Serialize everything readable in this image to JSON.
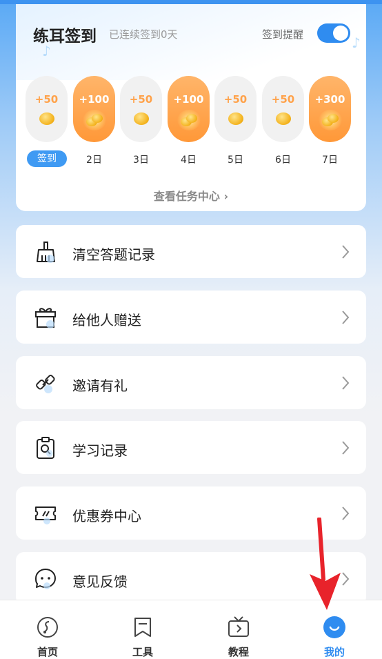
{
  "checkin": {
    "title": "练耳签到",
    "subtitle": "已连续签到0天",
    "reminder_label": "签到提醒",
    "reminder_on": true,
    "days": [
      {
        "points": "+50",
        "label": "签到",
        "big": false,
        "active": true
      },
      {
        "points": "+100",
        "label": "2日",
        "big": true,
        "active": false
      },
      {
        "points": "+50",
        "label": "3日",
        "big": false,
        "active": false
      },
      {
        "points": "+100",
        "label": "4日",
        "big": true,
        "active": false
      },
      {
        "points": "+50",
        "label": "5日",
        "big": false,
        "active": false
      },
      {
        "points": "+50",
        "label": "6日",
        "big": false,
        "active": false
      },
      {
        "points": "+300",
        "label": "7日",
        "big": true,
        "active": false
      }
    ],
    "task_center_link": "查看任务中心 ›"
  },
  "menu": [
    {
      "label": "清空答题记录",
      "icon": "broom-icon"
    },
    {
      "label": "给他人赠送",
      "icon": "gift-icon"
    },
    {
      "label": "邀请有礼",
      "icon": "link-icon"
    },
    {
      "label": "学习记录",
      "icon": "clipboard-search-icon"
    },
    {
      "label": "优惠券中心",
      "icon": "coupon-icon"
    },
    {
      "label": "意见反馈",
      "icon": "feedback-chat-icon"
    }
  ],
  "bottom_nav": [
    {
      "label": "首页",
      "icon": "home-note-icon",
      "active": false
    },
    {
      "label": "工具",
      "icon": "bookmark-icon",
      "active": false
    },
    {
      "label": "教程",
      "icon": "tv-play-icon",
      "active": false
    },
    {
      "label": "我的",
      "icon": "profile-smile-icon",
      "active": true
    }
  ],
  "colors": {
    "accent": "#2f8cf0",
    "orange": "#ff9d40",
    "annotation_arrow": "#e8232b"
  }
}
